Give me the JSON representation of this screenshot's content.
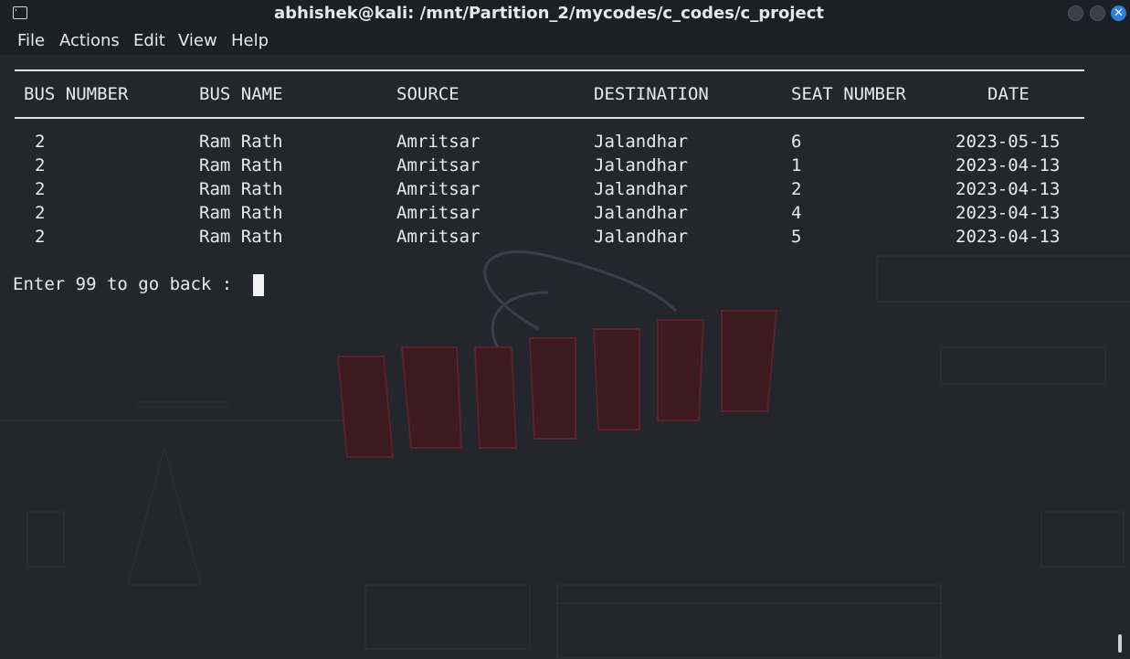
{
  "window": {
    "title": "abhishek@kali: /mnt/Partition_2/mycodes/c_codes/c_project",
    "close_glyph": "✕"
  },
  "menu": [
    "File",
    "Actions",
    "Edit",
    "View",
    "Help"
  ],
  "table": {
    "headers": [
      "BUS NUMBER",
      "BUS NAME",
      "SOURCE",
      "DESTINATION",
      "SEAT NUMBER",
      "DATE"
    ],
    "rows": [
      [
        "2",
        "Ram Rath",
        "Amritsar",
        "Jalandhar",
        "6",
        "2023-05-15"
      ],
      [
        "2",
        "Ram Rath",
        "Amritsar",
        "Jalandhar",
        "1",
        "2023-04-13"
      ],
      [
        "2",
        "Ram Rath",
        "Amritsar",
        "Jalandhar",
        "2",
        "2023-04-13"
      ],
      [
        "2",
        "Ram Rath",
        "Amritsar",
        "Jalandhar",
        "4",
        "2023-04-13"
      ],
      [
        "2",
        "Ram Rath",
        "Amritsar",
        "Jalandhar",
        "5",
        "2023-04-13"
      ]
    ]
  },
  "prompt": "Enter 99 to go back : ",
  "colors": {
    "terminal_bg": "#23272d",
    "text": "#e8eaed",
    "accent_close": "#2f7de1",
    "wallpaper_logo": "#6b1e24"
  },
  "icons": {
    "app": "terminal-icon",
    "minimize": "minimize-icon",
    "maximize": "maximize-icon",
    "close": "close-icon"
  }
}
